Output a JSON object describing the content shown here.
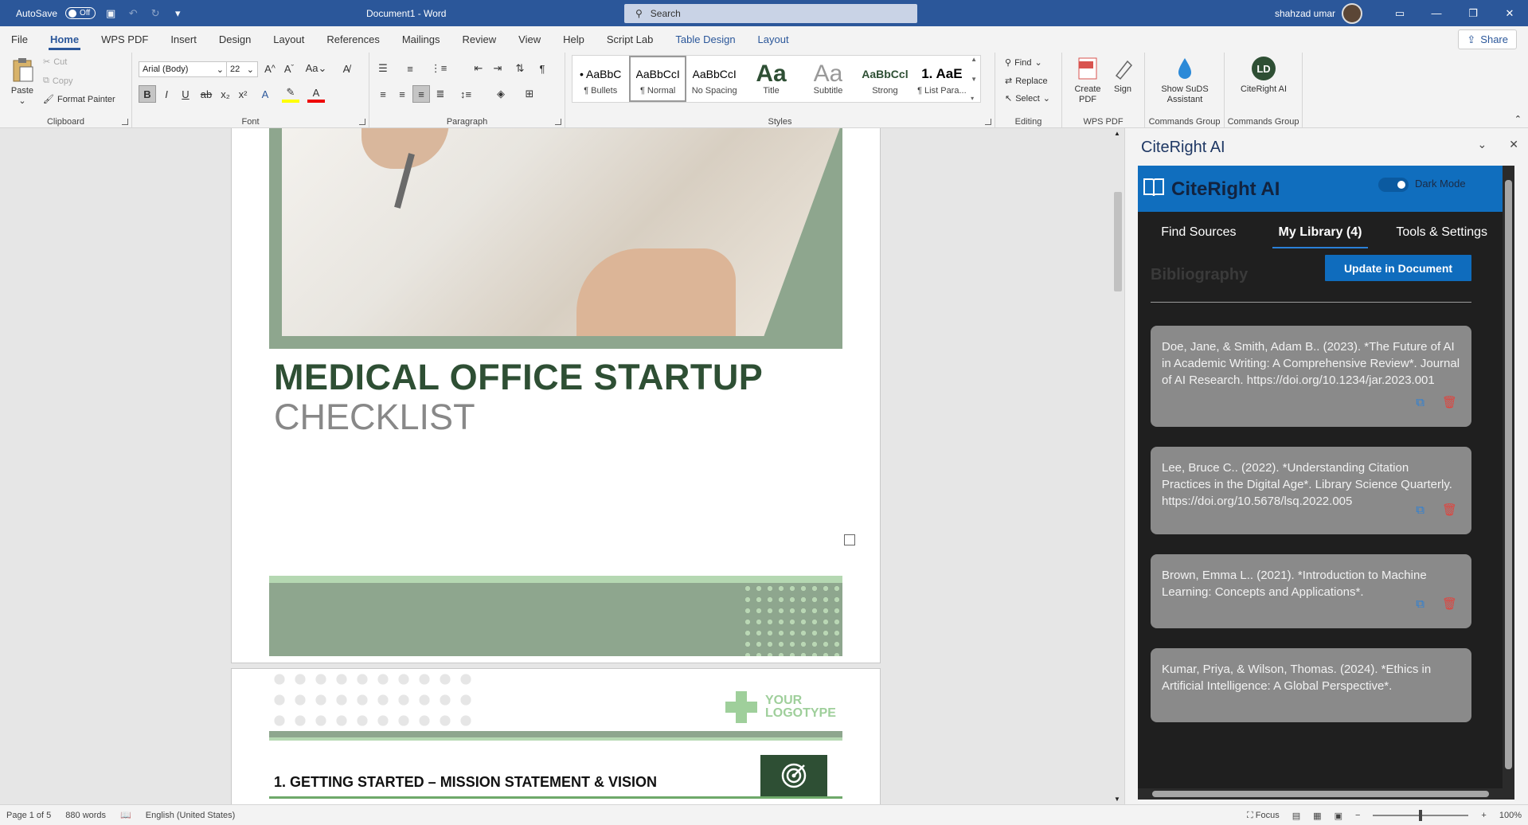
{
  "titlebar": {
    "autosave_label": "AutoSave",
    "autosave_state": "Off",
    "doc_title": "Document1  -  Word",
    "search_placeholder": "Search",
    "user_name": "shahzad umar"
  },
  "tabs": [
    "File",
    "Home",
    "WPS PDF",
    "Insert",
    "Design",
    "Layout",
    "References",
    "Mailings",
    "Review",
    "View",
    "Help",
    "Script Lab",
    "Table Design",
    "Layout"
  ],
  "share_label": "Share",
  "ribbon": {
    "clipboard": {
      "paste": "Paste",
      "cut": "Cut",
      "copy": "Copy",
      "format_painter": "Format Painter",
      "label": "Clipboard"
    },
    "font": {
      "name": "Arial (Body)",
      "size": "22",
      "label": "Font"
    },
    "paragraph": {
      "label": "Paragraph"
    },
    "styles": {
      "label": "Styles",
      "items": [
        {
          "preview": "• AaBbC",
          "name": "¶ Bullets"
        },
        {
          "preview": "AaBbCcI",
          "name": "¶ Normal"
        },
        {
          "preview": "AaBbCcI",
          "name": "No Spacing"
        },
        {
          "preview": "Aa",
          "name": "Title"
        },
        {
          "preview": "Aa",
          "name": "Subtitle"
        },
        {
          "preview": "AaBbCcl",
          "name": "Strong"
        },
        {
          "preview": "1. AaE",
          "name": "¶ List Para..."
        }
      ]
    },
    "editing": {
      "find": "Find",
      "replace": "Replace",
      "select": "Select",
      "label": "Editing"
    },
    "wps": {
      "create_pdf": "Create PDF",
      "sign": "Sign",
      "label": "WPS PDF"
    },
    "suds": {
      "button": "Show SuDS Assistant",
      "label": "Commands Group"
    },
    "citeright": {
      "button": "CiteRight AI",
      "label": "Commands Group"
    }
  },
  "document": {
    "title": "MEDICAL OFFICE STARTUP",
    "subtitle": "CHECKLIST",
    "logo_text": [
      "YOUR",
      "LOGOTYPE"
    ],
    "section_heading": "1.  GETTING STARTED – MISSION STATEMENT & VISION"
  },
  "pane": {
    "title": "CiteRight AI",
    "addin_name": "CiteRight AI",
    "dark_mode_label": "Dark Mode",
    "tabs": [
      "Find Sources",
      "My Library (4)",
      "Tools & Settings"
    ],
    "bibliography_label": "Bibliography",
    "update_button": "Update in Document",
    "citations": [
      "Doe, Jane, & Smith, Adam B.. (2023). *The Future of AI in Academic Writing: A Comprehensive Review*. Journal of AI Research. https://doi.org/10.1234/jar.2023.001",
      "Lee, Bruce C.. (2022). *Understanding Citation Practices in the Digital Age*. Library Science Quarterly. https://doi.org/10.5678/lsq.2022.005",
      "Brown, Emma L.. (2021). *Introduction to Machine Learning: Concepts and Applications*.",
      "Kumar, Priya, & Wilson, Thomas. (2024). *Ethics in Artificial Intelligence: A Global Perspective*."
    ]
  },
  "status": {
    "page": "Page 1 of 5",
    "words": "880 words",
    "language": "English (United States)",
    "focus": "Focus",
    "zoom": "100%"
  },
  "colors": {
    "title_bar": "#2b579a",
    "heading_green": "#2e4f34",
    "sage": "#8ea68e",
    "accent_blue": "#0f6cbd",
    "card_gray": "#8a8a8a"
  }
}
